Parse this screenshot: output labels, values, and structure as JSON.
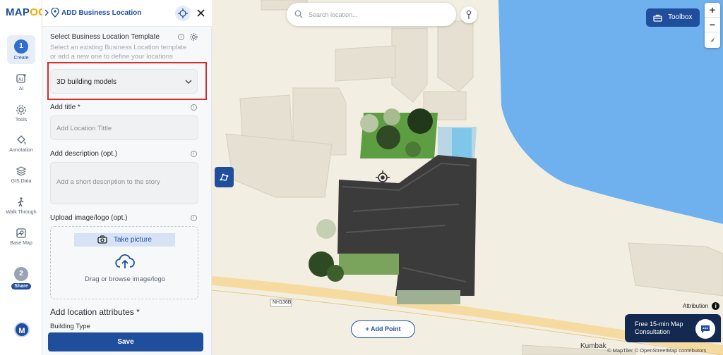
{
  "app": {
    "logo_left": "MAP",
    "logo_right": "OG"
  },
  "rail": {
    "create_step": "1",
    "create_label": "Create",
    "items": [
      "AI",
      "Tools",
      "Annotation",
      "GIS Data",
      "Walk Through",
      "Base Map"
    ],
    "share_step": "2",
    "share_label": "Share",
    "avatar": "M"
  },
  "panel": {
    "title": "ADD Business Location",
    "template_label": "Select Business Location Template",
    "template_help": "Select an existing Business Location template or add a new one to define your locations",
    "template_value": "3D building models",
    "title_label": "Add title *",
    "title_placeholder": "Add Location Tittle",
    "desc_label": "Add description (opt.)",
    "desc_placeholder": "Add a short description to the story",
    "upload_label": "Upload image/logo (opt.)",
    "take_picture": "Take picture",
    "drag_text": "Drag or browse image/logo",
    "attributes_title": "Add location attributes *",
    "building_type_label": "Building Type",
    "save_label": "Save"
  },
  "map": {
    "search_placeholder": "Search location...",
    "toolbox_label": "Toolbox",
    "zoom_in": "+",
    "zoom_out": "−",
    "add_point_label": "+ Add Point",
    "attribution_label": "Attribution",
    "consult_label": "Free 15-min Map Consultation",
    "road_label": "NH136B",
    "street_label": "Kumbak",
    "copyright": "© MapTiler © OpenStreetMap contributors"
  },
  "colors": {
    "brand": "#1f4e9c",
    "accent": "#f2a900",
    "water": "#5aa9ef",
    "highlight": "#d32f2f"
  }
}
